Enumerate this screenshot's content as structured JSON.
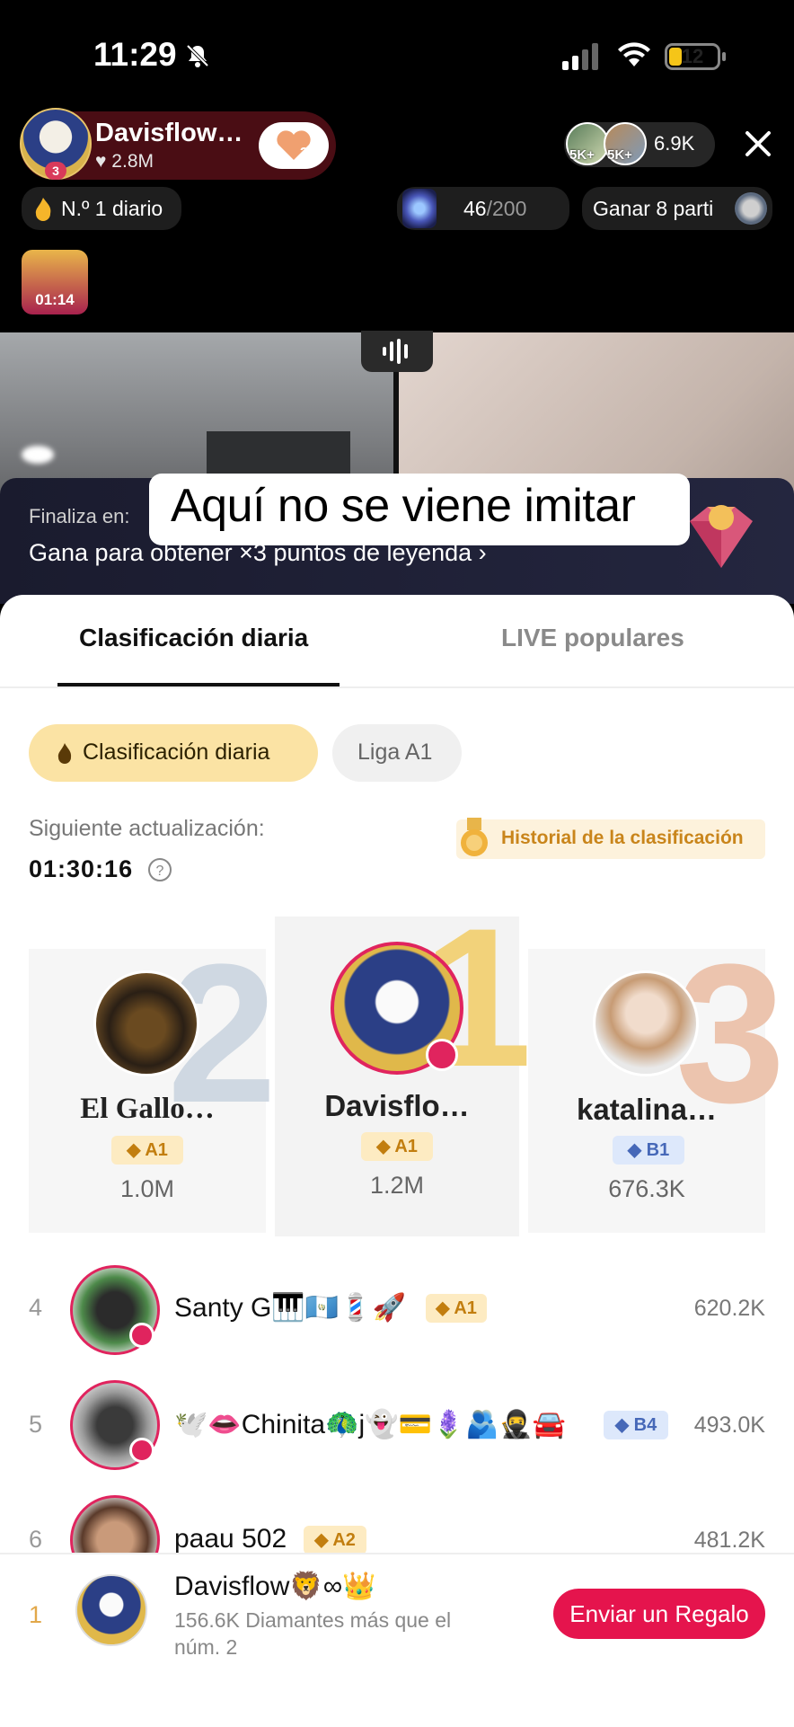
{
  "status_bar": {
    "time": "11:29",
    "battery": "12"
  },
  "header": {
    "host_name": "Davisflow…",
    "host_likes": "♥ 2.8M",
    "host_level": "3",
    "follow_badge": "3",
    "viewer_badge_1": "5K+",
    "viewer_badge_2": "5K+",
    "viewer_count": "6.9K",
    "daily_rank": "N.º 1 diario",
    "progress_current": "46",
    "progress_total": "/200",
    "ganar": "Ganar 8 parti",
    "chest_timer": "01:14"
  },
  "promo": {
    "finaliza": "Finaliza en:",
    "gana": "Gana para obtener ×3 puntos de leyenda",
    "caption": "Aquí no se viene imitar"
  },
  "tabs": {
    "active": "Clasificación diaria",
    "inactive": "LIVE populares"
  },
  "filters": {
    "active": "Clasificación diaria",
    "inactive": "Liga A1"
  },
  "update": {
    "label": "Siguiente actualización:",
    "timer": "01:30:16",
    "history": "Historial de la clasificación"
  },
  "podium": [
    {
      "rank": "2",
      "name": "El Gallo…",
      "league": "A1",
      "score": "1.0M"
    },
    {
      "rank": "1",
      "name": "Davisflo…",
      "league": "A1",
      "score": "1.2M"
    },
    {
      "rank": "3",
      "name": "katalina…",
      "league": "B1",
      "score": "676.3K"
    }
  ],
  "rows": [
    {
      "rank": "4",
      "name": "Santy G🎹🇬🇹💈🚀",
      "league": "A1",
      "score": "620.2K"
    },
    {
      "rank": "5",
      "name": "🕊️👄Chinita🦚j👻💳🪻🫂🥷🚘",
      "league": "B4",
      "score": "493.0K"
    },
    {
      "rank": "6",
      "name": "paau 502",
      "league": "A2",
      "score": "481.2K"
    }
  ],
  "bottom": {
    "rank": "1",
    "name": "Davisflow🦁∞👑",
    "sub": "156.6K Diamantes más que el núm. 2",
    "button": "Enviar un Regalo"
  },
  "colors": {
    "accent": "#e5144d",
    "gold": "#f2d27a",
    "chip": "#fbe3a4"
  }
}
